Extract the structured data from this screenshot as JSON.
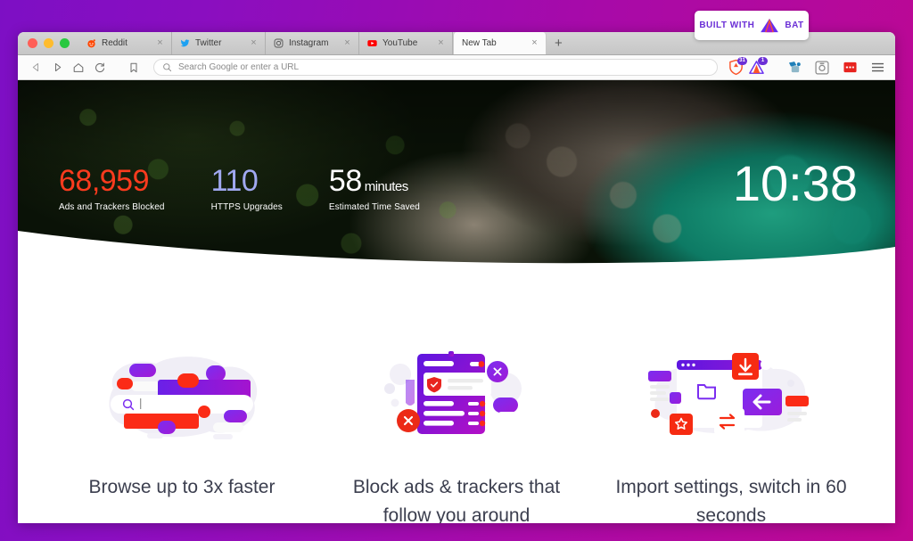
{
  "badge": {
    "prefix": "BUILT WITH",
    "suffix": "BAT",
    "logo_icon": "bat-triangle-icon",
    "accent": "#6b2fd6",
    "accent_red": "#fb542b"
  },
  "window": {
    "traffic_lights": [
      "close",
      "minimize",
      "zoom"
    ],
    "tabs": [
      {
        "title": "Reddit",
        "favicon": "reddit-icon",
        "active": false,
        "close": "×"
      },
      {
        "title": "Twitter",
        "favicon": "twitter-icon",
        "active": false,
        "close": "×"
      },
      {
        "title": "Instagram",
        "favicon": "instagram-icon",
        "active": false,
        "close": "×"
      },
      {
        "title": "YouTube",
        "favicon": "youtube-icon",
        "active": false,
        "close": "×"
      },
      {
        "title": "New Tab",
        "favicon": "blank-icon",
        "active": true,
        "close": "×"
      }
    ],
    "new_tab_label": "+"
  },
  "toolbar": {
    "back_icon": "back-arrow-icon",
    "forward_icon": "forward-arrow-icon",
    "home_icon": "home-icon",
    "reload_icon": "reload-icon",
    "bookmark_icon": "bookmark-icon",
    "search_placeholder": "Search Google or enter a URL",
    "search_value": "",
    "search_icon": "magnifier-icon",
    "shield": {
      "icon": "brave-shield-icon",
      "count": "31"
    },
    "rewards": {
      "icon": "brave-rewards-triangle-icon",
      "count": "1"
    },
    "sync_icon": "brave-sync-icon",
    "screenshot_icon": "screenshot-camera-icon",
    "extension_icon": "red-extension-icon",
    "menu_icon": "hamburger-menu-icon"
  },
  "hero": {
    "clock": "10:38",
    "stats": [
      {
        "value": "68,959",
        "unit": "",
        "label": "Ads and Trackers Blocked",
        "color": "#fb3b1e"
      },
      {
        "value": "110",
        "unit": "",
        "label": "HTTPS Upgrades",
        "color": "#a0a8f0"
      },
      {
        "value": "58",
        "unit": "minutes",
        "label": "Estimated Time Saved",
        "color": "#ffffff"
      }
    ]
  },
  "features": [
    {
      "caption": "Browse up to 3x faster",
      "art": "speed-search-illustration"
    },
    {
      "caption": "Block ads & trackers that follow you around",
      "art": "shield-card-illustration"
    },
    {
      "caption": "Import settings, switch in 60 seconds",
      "art": "import-settings-illustration"
    }
  ]
}
